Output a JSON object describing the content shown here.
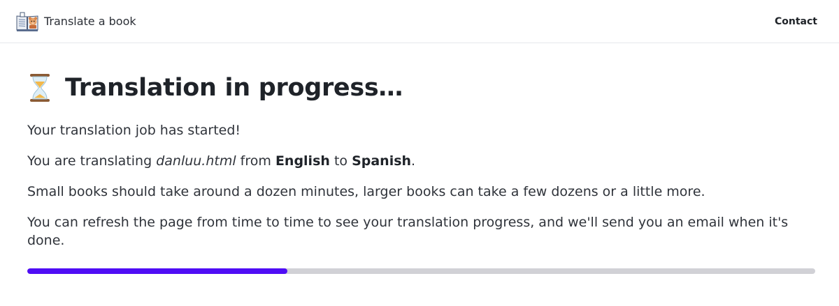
{
  "header": {
    "brand_name": "Translate a book",
    "brand_icon": "book-translate-icon",
    "contact_label": "Contact"
  },
  "main": {
    "title_icon": "hourglass-icon",
    "title": "Translation in progress…",
    "started_text": "Your translation job has started!",
    "job": {
      "prefix": "You are translating ",
      "filename": "danluu.html",
      "from_text": " from ",
      "source_language": "English",
      "to_text": " to ",
      "target_language": "Spanish",
      "suffix": "."
    },
    "duration_text": "Small books should take around a dozen minutes, larger books can take a few dozens or a little more.",
    "refresh_text": "You can refresh the page from time to time to see your translation progress, and we'll send you an email when it's done.",
    "progress": {
      "fraction": 0.33,
      "fill_color": "#4f0df5",
      "track_color": "#d1d1d6"
    }
  }
}
